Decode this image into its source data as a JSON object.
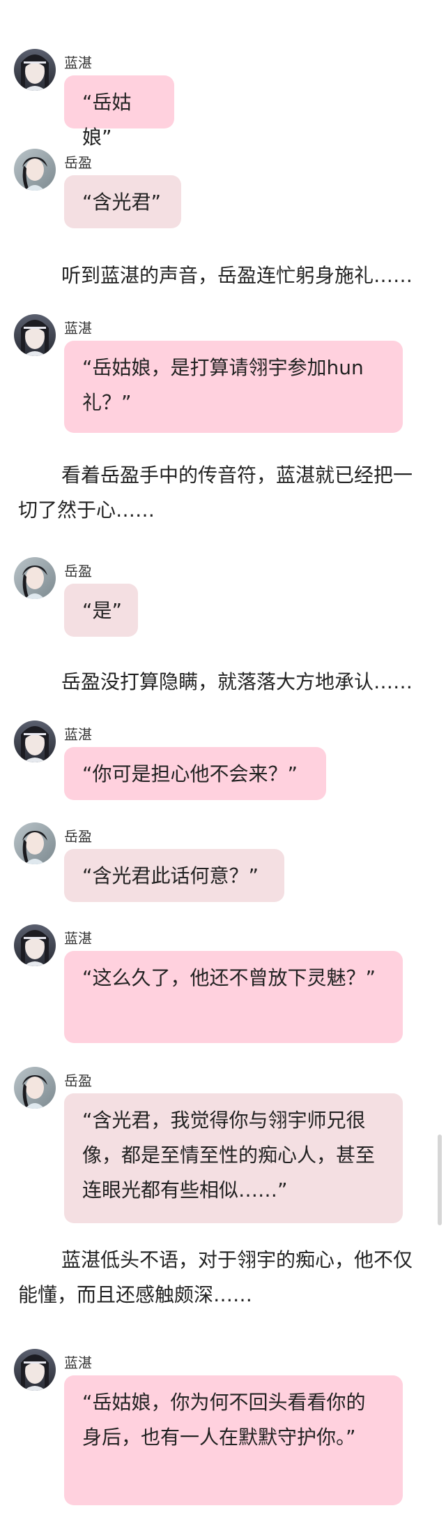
{
  "colors": {
    "lanzhan_bubble": "#ffd1de",
    "yueying_bubble": "#f4dfe2"
  },
  "messages": [
    {
      "speaker": "蓝湛",
      "text": "“岳姑娘”"
    },
    {
      "speaker": "岳盈",
      "text": "“含光君”"
    },
    {
      "narration": "听到蓝湛的声音，岳盈连忙躬身施礼……"
    },
    {
      "speaker": "蓝湛",
      "text": "“岳姑娘，是打算请翎宇参加hun礼？”"
    },
    {
      "narration": "看着岳盈手中的传音符，蓝湛就已经把一切了然于心……"
    },
    {
      "speaker": "岳盈",
      "text": "“是”"
    },
    {
      "narration": "岳盈没打算隐瞒，就落落大方地承认……"
    },
    {
      "speaker": "蓝湛",
      "text": "“你可是担心他不会来？”"
    },
    {
      "speaker": "岳盈",
      "text": "“含光君此话何意？”"
    },
    {
      "speaker": "蓝湛",
      "text": "“这么久了，他还不曾放下灵魅？”"
    },
    {
      "speaker": "岳盈",
      "text": "“含光君，我觉得你与翎宇师兄很像，都是至情至性的痴心人，甚至连眼光都有些相似……”"
    },
    {
      "narration": "蓝湛低头不语，对于翎宇的痴心，他不仅能懂，而且还感触颇深……"
    },
    {
      "speaker": "蓝湛",
      "text": "“岳姑娘，你为何不回头看看你的身后，也有一人在默默守护你。”"
    }
  ]
}
